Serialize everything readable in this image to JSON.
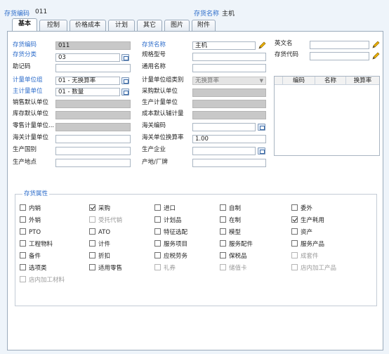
{
  "header": {
    "code_label": "存货编码",
    "code_value": "011",
    "name_label": "存货名称",
    "name_value": "主机"
  },
  "tabs": [
    {
      "label": "基本",
      "active": true
    },
    {
      "label": "控制"
    },
    {
      "label": "价格成本"
    },
    {
      "label": "计划"
    },
    {
      "label": "其它"
    },
    {
      "label": "图片"
    },
    {
      "label": "附件"
    }
  ],
  "form": {
    "col1": [
      {
        "label": "存货编码",
        "value": "011",
        "blue": true
      },
      {
        "label": "存货分类",
        "value": "03",
        "blue": true
      },
      {
        "label": "助记码",
        "value": ""
      },
      {
        "label": "计量单位组",
        "value": "01 - 无换算率",
        "blue": true
      },
      {
        "label": "主计量单位",
        "value": "01 - 数量",
        "blue": true
      },
      {
        "label": "销售默认单位",
        "value": ""
      },
      {
        "label": "库存默认单位",
        "value": ""
      },
      {
        "label": "零售计量单位...",
        "value": ""
      },
      {
        "label": "海关计量单位",
        "value": ""
      },
      {
        "label": "生产国别",
        "value": ""
      },
      {
        "label": "生产地点",
        "value": ""
      }
    ],
    "col2": [
      {
        "label": "存货名称",
        "value": "主机",
        "blue": true
      },
      {
        "label": "规格型号",
        "value": ""
      },
      {
        "label": "通用名称",
        "value": ""
      },
      {
        "label": "计量单位组类别",
        "value": "无换算率"
      },
      {
        "label": "采购默认单位",
        "value": ""
      },
      {
        "label": "生产计量单位",
        "value": ""
      },
      {
        "label": "成本默认辅计量",
        "value": ""
      },
      {
        "label": "海关编码",
        "value": ""
      },
      {
        "label": "海关单位换算率",
        "value": "1.00"
      },
      {
        "label": "生产企业",
        "value": ""
      },
      {
        "label": "产地/厂牌",
        "value": ""
      }
    ],
    "col3": [
      {
        "label": "英文名",
        "value": ""
      },
      {
        "label": "存货代码",
        "value": ""
      }
    ]
  },
  "grid": {
    "columns": [
      "编码",
      "名称",
      "换算率"
    ]
  },
  "attributes": {
    "title": "存货属性",
    "items": [
      {
        "label": "内销",
        "checked": false,
        "disabled": false
      },
      {
        "label": "采购",
        "checked": true,
        "disabled": false
      },
      {
        "label": "进口",
        "checked": false,
        "disabled": false
      },
      {
        "label": "自制",
        "checked": false,
        "disabled": false
      },
      {
        "label": "委外",
        "checked": false,
        "disabled": false
      },
      {
        "label": "外销",
        "checked": false,
        "disabled": false
      },
      {
        "label": "受托代销",
        "checked": false,
        "disabled": true
      },
      {
        "label": "计划品",
        "checked": false,
        "disabled": false
      },
      {
        "label": "在制",
        "checked": false,
        "disabled": false
      },
      {
        "label": "生产耗用",
        "checked": true,
        "disabled": false
      },
      {
        "label": "PTO",
        "checked": false,
        "disabled": false
      },
      {
        "label": "ATO",
        "checked": false,
        "disabled": false
      },
      {
        "label": "特征选配",
        "checked": false,
        "disabled": false
      },
      {
        "label": "模型",
        "checked": false,
        "disabled": false
      },
      {
        "label": "资产",
        "checked": false,
        "disabled": false
      },
      {
        "label": "工程物料",
        "checked": false,
        "disabled": false
      },
      {
        "label": "计件",
        "checked": false,
        "disabled": false
      },
      {
        "label": "服务项目",
        "checked": false,
        "disabled": false
      },
      {
        "label": "服务配件",
        "checked": false,
        "disabled": false
      },
      {
        "label": "服务产品",
        "checked": false,
        "disabled": false
      },
      {
        "label": "备件",
        "checked": false,
        "disabled": false
      },
      {
        "label": "折扣",
        "checked": false,
        "disabled": false
      },
      {
        "label": "应税劳务",
        "checked": false,
        "disabled": false
      },
      {
        "label": "保税品",
        "checked": false,
        "disabled": false
      },
      {
        "label": "成套件",
        "checked": false,
        "disabled": true
      },
      {
        "label": "选项类",
        "checked": false,
        "disabled": false
      },
      {
        "label": "适用零售",
        "checked": false,
        "disabled": false
      },
      {
        "label": "礼券",
        "checked": false,
        "disabled": true
      },
      {
        "label": "储值卡",
        "checked": false,
        "disabled": true
      },
      {
        "label": "店内加工产品",
        "checked": false,
        "disabled": true
      },
      {
        "label": "店内加工材料",
        "checked": false,
        "disabled": true
      }
    ]
  },
  "colors": {
    "accent": "#2f6ecb",
    "panel_bg": "#ffffff",
    "window_bg": "#eef4fa"
  }
}
